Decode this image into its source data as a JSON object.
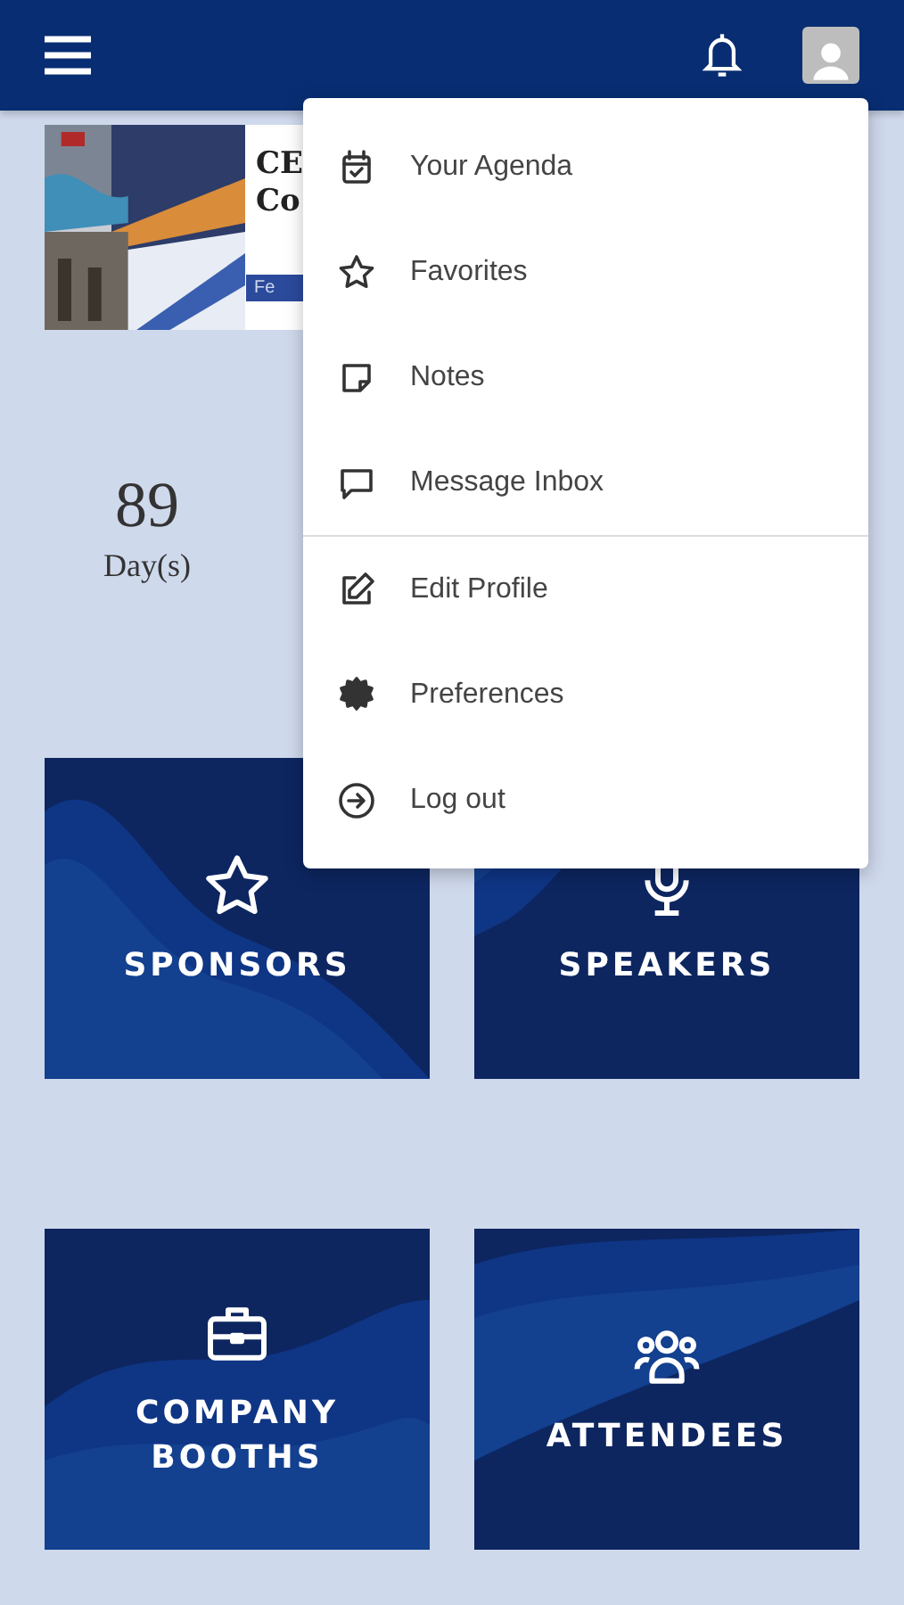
{
  "banner": {
    "title_lines": [
      "CE",
      "Co"
    ],
    "strip_text": "Fe"
  },
  "countdown": {
    "value": "89",
    "unit": "Day(s)"
  },
  "menu": {
    "sections": [
      [
        {
          "label": "Your Agenda"
        },
        {
          "label": "Favorites"
        },
        {
          "label": "Notes"
        },
        {
          "label": "Message Inbox"
        }
      ],
      [
        {
          "label": "Edit Profile"
        },
        {
          "label": "Preferences"
        },
        {
          "label": "Log out"
        }
      ]
    ]
  },
  "tiles": [
    {
      "lines": [
        "SPONSORS"
      ]
    },
    {
      "lines": [
        "SPEAKERS"
      ]
    },
    {
      "lines": [
        "COMPANY",
        "BOOTHS"
      ]
    },
    {
      "lines": [
        "ATTENDEES"
      ]
    }
  ]
}
